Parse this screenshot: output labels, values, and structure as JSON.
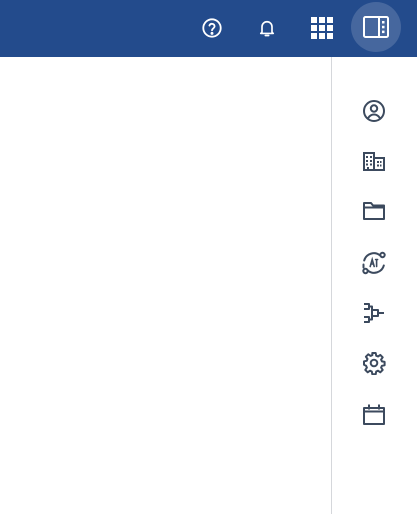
{
  "header": {
    "background_color": "#234b8c",
    "icon_color": "#ffffff",
    "buttons": [
      {
        "icon": "help-circle-icon"
      },
      {
        "icon": "bell-icon"
      },
      {
        "icon": "apps-grid-icon"
      },
      {
        "icon": "side-panel-icon",
        "active": true
      }
    ]
  },
  "side_panel": {
    "icon_color": "#3c4a5e",
    "divider_color": "#d5d7db",
    "items": [
      {
        "icon": "user-account-icon"
      },
      {
        "icon": "building-icon"
      },
      {
        "icon": "folder-icon"
      },
      {
        "icon": "ai-sync-icon"
      },
      {
        "icon": "workflow-icon"
      },
      {
        "icon": "gear-icon"
      },
      {
        "icon": "calendar-board-icon"
      }
    ]
  }
}
